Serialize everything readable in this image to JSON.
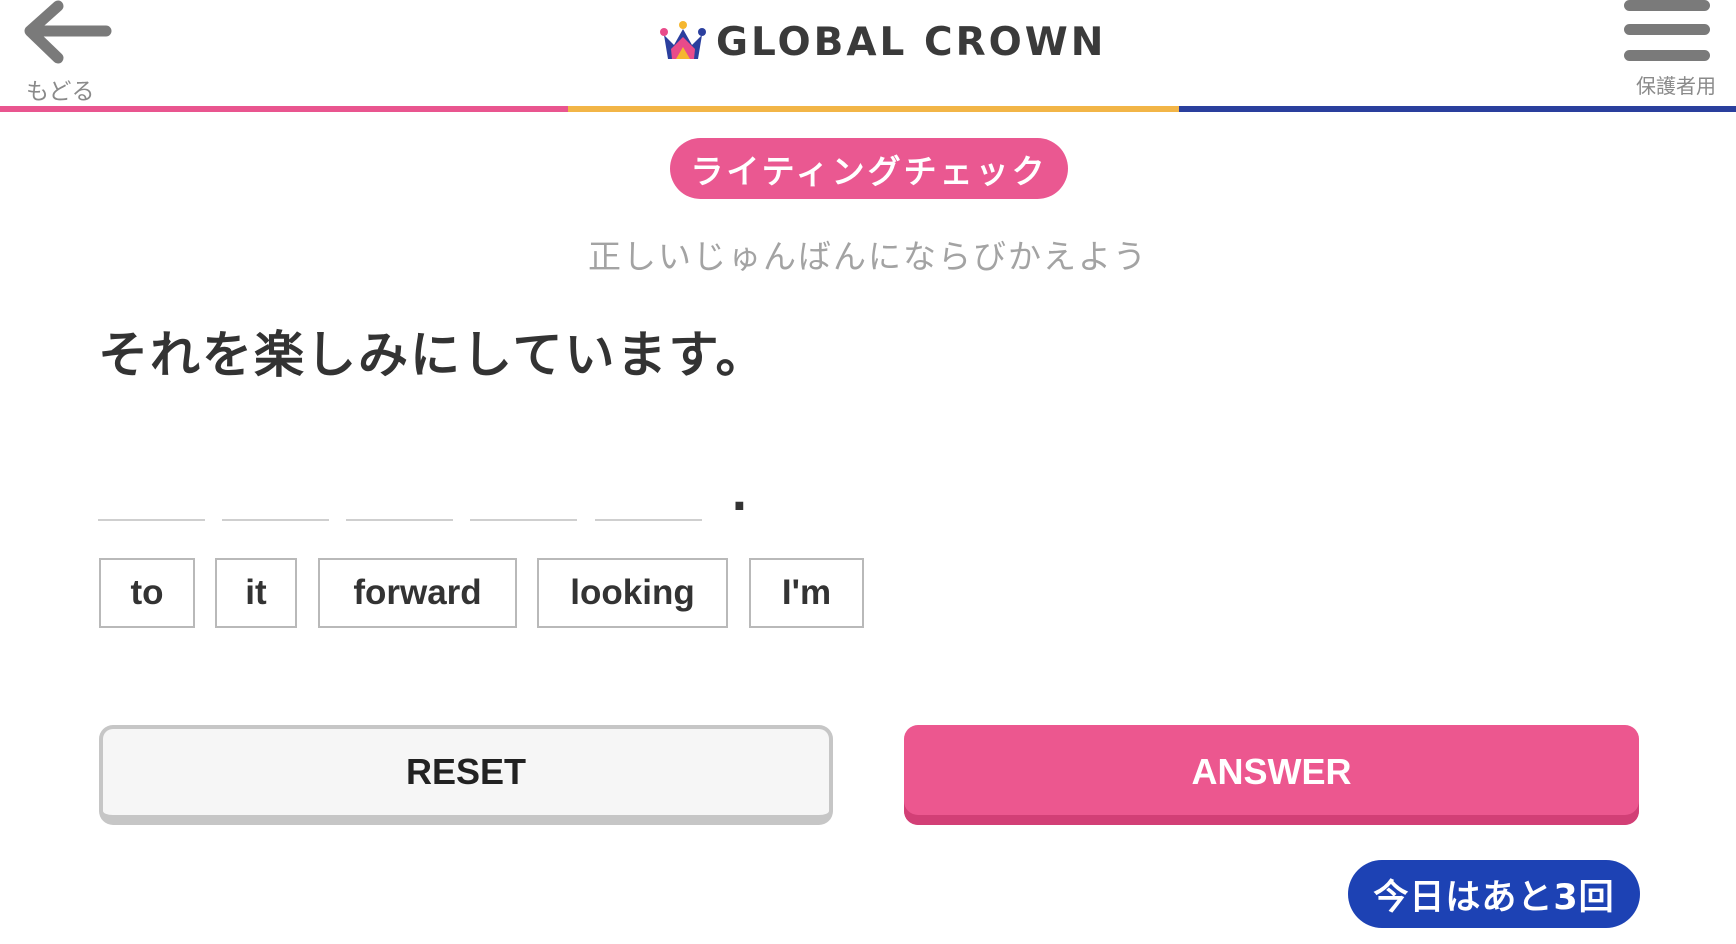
{
  "header": {
    "back_label": "もどる",
    "logo_text": "GLOBAL CROWN",
    "menu_label": "保護者用",
    "color_line": [
      "#e9558f",
      "#f2b547",
      "#2a3f9d"
    ]
  },
  "mode_title": "ライティングチェック",
  "instruction": "正しいじゅんばんにならびかえよう",
  "question": "それを楽しみにしています。",
  "answer_slots": 5,
  "sentence_end": ".",
  "word_choices": [
    "to",
    "it",
    "forward",
    "looking",
    "I'm"
  ],
  "buttons": {
    "reset": "RESET",
    "answer": "ANSWER"
  },
  "remaining_text": "今日はあと3回",
  "colors": {
    "accent_pink": "#ea5891",
    "badge_blue": "#1d42b4"
  }
}
